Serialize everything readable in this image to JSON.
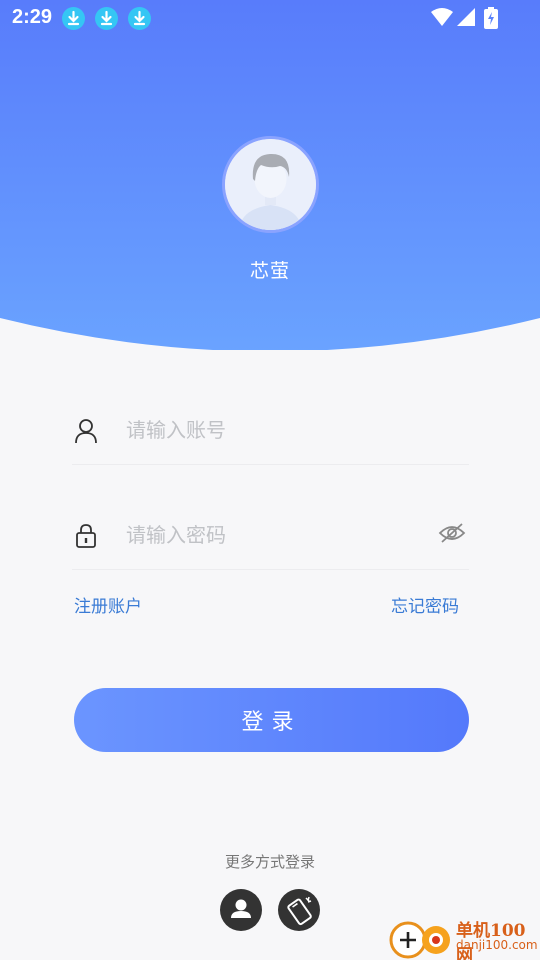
{
  "status_bar": {
    "time": "2:29",
    "download_icons": [
      "download-icon",
      "download-icon",
      "download-icon"
    ],
    "system_icons": [
      "wifi-icon",
      "cellular-signal-icon",
      "battery-charging-icon"
    ]
  },
  "header": {
    "gradient_top": "#587cfb",
    "gradient_bottom": "#6aa3ff",
    "avatar_icon": "user-avatar-icon",
    "username": "芯萤"
  },
  "form": {
    "account": {
      "icon": "user-icon",
      "placeholder": "请输入账号",
      "value": ""
    },
    "password": {
      "icon": "lock-icon",
      "placeholder": "请输入密码",
      "value": "",
      "toggle_icon": "eye-off-icon"
    }
  },
  "links": {
    "register": "注册账户",
    "forgot": "忘记密码"
  },
  "login_button": {
    "label": "登录"
  },
  "more_login": {
    "label": "更多方式登录",
    "options": [
      {
        "icon": "person-icon"
      },
      {
        "icon": "phone-icon"
      }
    ]
  },
  "colors": {
    "accent": "#5479fb",
    "link": "#3a7bd5",
    "background": "#f7f7f9"
  },
  "watermark": {
    "name": "单机100网",
    "url": "danji100.com"
  }
}
